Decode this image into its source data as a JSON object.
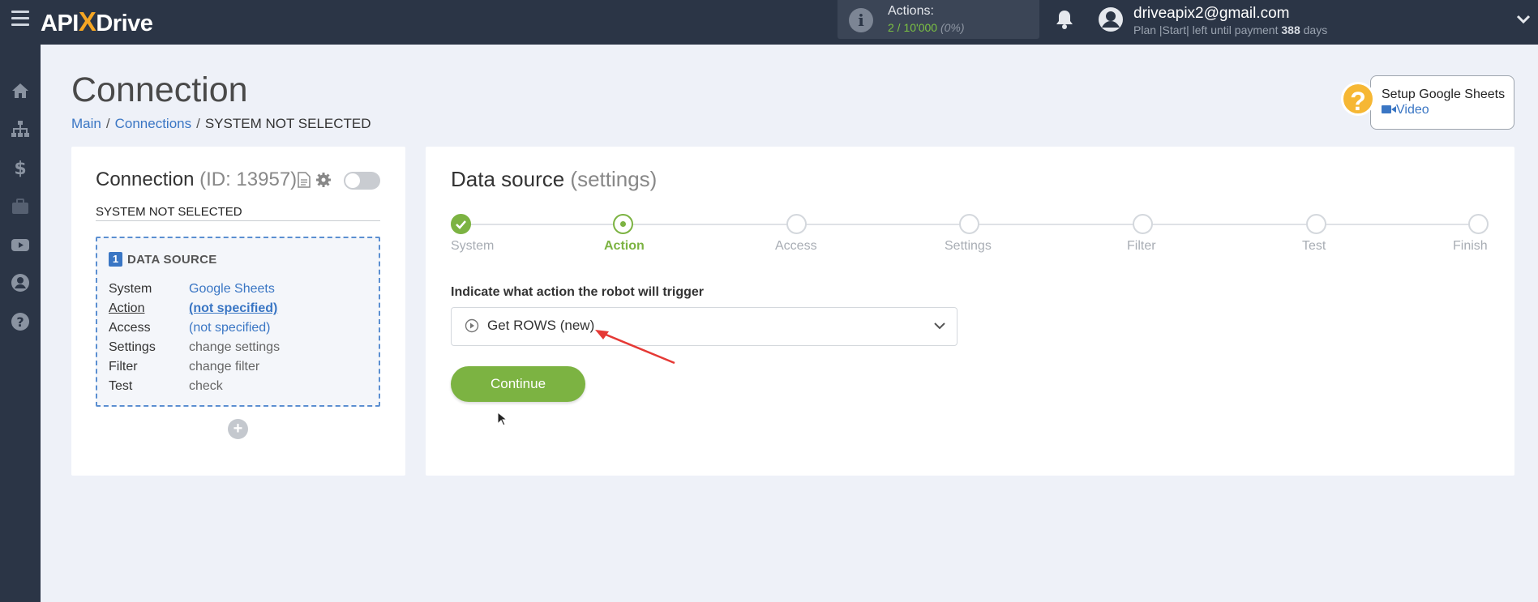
{
  "topbar": {
    "logo_left": "API",
    "logo_x": "X",
    "logo_right": "Drive",
    "actions_label": "Actions:",
    "actions_value": "2 / 10'000",
    "actions_percent": "(0%)",
    "email": "driveapix2@gmail.com",
    "plan_prefix": "Plan |Start| left until payment",
    "plan_days": "388",
    "plan_suffix": "days"
  },
  "sidebar": {
    "items": [
      "home-icon",
      "sitemap-icon",
      "dollar-icon",
      "briefcase-icon",
      "youtube-icon",
      "user-icon",
      "question-icon"
    ]
  },
  "page": {
    "title": "Connection",
    "breadcrumb": {
      "main": "Main",
      "sep1": "/",
      "connections": "Connections",
      "sep2": "/",
      "current": "SYSTEM NOT SELECTED"
    }
  },
  "help": {
    "icon": "?",
    "title": "Setup Google Sheets",
    "video": "Video"
  },
  "connection": {
    "title": "Connection",
    "id_text": "(ID: 13957)",
    "system_name": "SYSTEM NOT SELECTED",
    "data_source": {
      "number": "1",
      "heading": "DATA SOURCE",
      "rows": [
        {
          "label": "System",
          "value": "Google Sheets"
        },
        {
          "label": "Action",
          "value": "(not specified)"
        },
        {
          "label": "Access",
          "value": "(not specified)"
        },
        {
          "label": "Settings",
          "value": "change settings"
        },
        {
          "label": "Filter",
          "value": "change filter"
        },
        {
          "label": "Test",
          "value": "check"
        }
      ]
    },
    "add_label": "+"
  },
  "data_source_panel": {
    "title": "Data source",
    "subtitle": "(settings)",
    "steps": [
      "System",
      "Action",
      "Access",
      "Settings",
      "Filter",
      "Test",
      "Finish"
    ],
    "current_step": "Action",
    "indicate_label": "Indicate what action the robot will trigger",
    "selected_action": "Get ROWS (new)",
    "continue_label": "Continue"
  },
  "colors": {
    "topbar": "#2b3546",
    "accent_green": "#7cb342",
    "link_blue": "#3a76c4",
    "logo_orange": "#f5a623"
  }
}
